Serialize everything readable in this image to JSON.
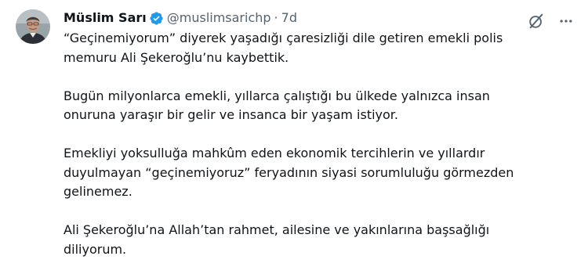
{
  "tweet": {
    "author_name": "Müslim Sarı",
    "handle": "@muslimsarichp",
    "separator": "·",
    "time": "7d",
    "paragraphs": [
      "“Geçinemiyorum” diyerek yaşadığı çaresizliği dile getiren emekli polis memuru Ali Şekeroğlu’nu kaybettik.",
      "Bugün milyonlarca emekli, yıllarca çalıştığı bu ülkede yalnızca insan onuruna yaraşır bir gelir ve insanca bir yaşam istiyor.",
      "Emekliyi yoksulluğa mahkûm eden ekonomik tercihlerin ve yıllardır duyulmayan “geçinemiyoruz” feryadının siyasi sorumluluğu görmezden gelinemez.",
      "Ali Şekeroğlu’na Allah’tan rahmet, ailesine ve yakınlarına başsağlığı diliyorum."
    ]
  },
  "icons": {
    "verified": "verified-badge-icon",
    "grok": "grok-icon",
    "more": "more-icon"
  },
  "colors": {
    "text": "#0f1419",
    "secondary": "#536471",
    "verified": "#1d9bf0",
    "background": "#ffffff"
  }
}
